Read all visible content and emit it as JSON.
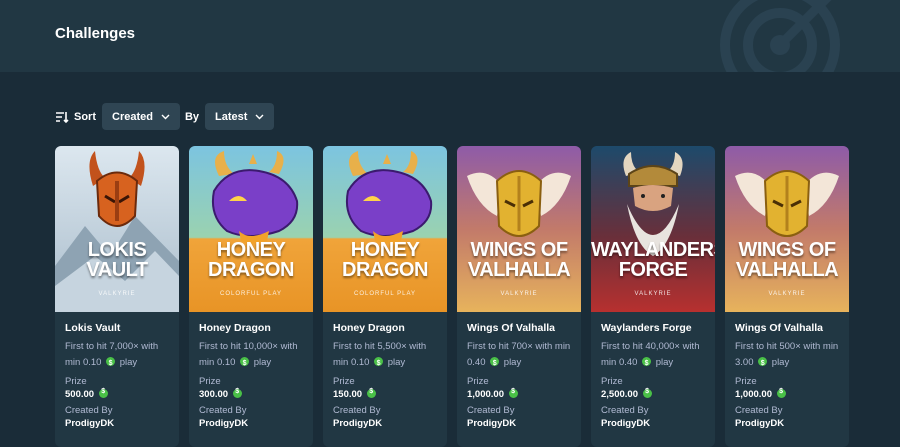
{
  "page": {
    "title": "Challenges"
  },
  "controls": {
    "sort_label": "Sort",
    "sort_value": "Created",
    "by_label": "By",
    "by_value": "Latest"
  },
  "cards": [
    {
      "game": "Lokis Vault",
      "art_title_1": "LOKIS",
      "art_title_2": "VAULT",
      "art_sub": "VALKYRIE",
      "desc_1": "First to hit 7,000× with",
      "desc_2_pre": "min 0.10",
      "desc_2_post": "play",
      "prize_label": "Prize",
      "prize": "500.00",
      "created_label": "Created By",
      "creator": "ProdigyDK",
      "theme": "snow"
    },
    {
      "game": "Honey Dragon",
      "art_title_1": "HONEY",
      "art_title_2": "DRAGON",
      "art_sub": "COLORFUL PLAY",
      "desc_1": "First to hit 10,000× with",
      "desc_2_pre": "min 0.10",
      "desc_2_post": "play",
      "prize_label": "Prize",
      "prize": "300.00",
      "created_label": "Created By",
      "creator": "ProdigyDK",
      "theme": "dragon"
    },
    {
      "game": "Honey Dragon",
      "art_title_1": "HONEY",
      "art_title_2": "DRAGON",
      "art_sub": "COLORFUL PLAY",
      "desc_1": "First to hit 5,500× with",
      "desc_2_pre": "min 0.10",
      "desc_2_post": "play",
      "prize_label": "Prize",
      "prize": "150.00",
      "created_label": "Created By",
      "creator": "ProdigyDK",
      "theme": "dragon"
    },
    {
      "game": "Wings Of Valhalla",
      "art_title_1": "WINGS OF",
      "art_title_2": "VALHALLA",
      "art_sub": "VALKYRIE",
      "desc_1": "First to hit 700× with min",
      "desc_2_pre": "0.40",
      "desc_2_post": "play",
      "prize_label": "Prize",
      "prize": "1,000.00",
      "created_label": "Created By",
      "creator": "ProdigyDK",
      "theme": "wings"
    },
    {
      "game": "Waylanders Forge",
      "art_title_1": "WAYLANDERS",
      "art_title_2": "FORGE",
      "art_sub": "VALKYRIE",
      "desc_1": "First to hit 40,000× with",
      "desc_2_pre": "min 0.40",
      "desc_2_post": "play",
      "prize_label": "Prize",
      "prize": "2,500.00",
      "created_label": "Created By",
      "creator": "ProdigyDK",
      "theme": "forge"
    },
    {
      "game": "Wings Of Valhalla",
      "art_title_1": "WINGS OF",
      "art_title_2": "VALHALLA",
      "art_sub": "VALKYRIE",
      "desc_1": "First to hit 500× with min",
      "desc_2_pre": "3.00",
      "desc_2_post": "play",
      "prize_label": "Prize",
      "prize": "1,000.00",
      "created_label": "Created By",
      "creator": "ProdigyDK",
      "theme": "wings"
    }
  ],
  "colors": {
    "bg": "#1a2c38",
    "header": "#213743",
    "control": "#2f4553",
    "muted": "#b1bad3",
    "coin": "#49c047"
  }
}
